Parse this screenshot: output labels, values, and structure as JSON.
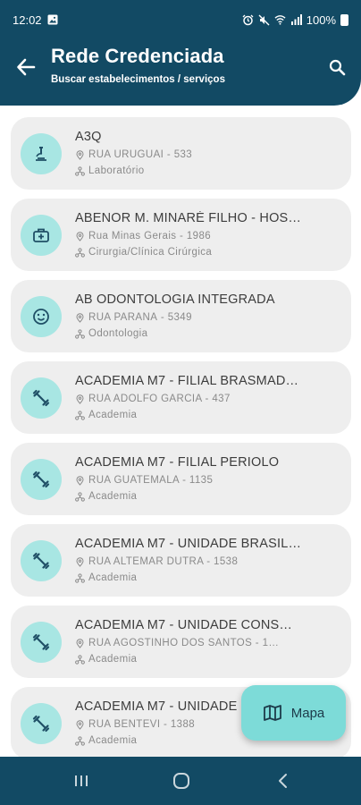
{
  "status_bar": {
    "time": "12:02",
    "battery": "100%"
  },
  "header": {
    "title": "Rede Credenciada",
    "subtitle": "Buscar estabelecimentos / serviços"
  },
  "items": [
    {
      "name": "A3Q",
      "address": "RUA URUGUAI - 533",
      "category": "Laboratório",
      "icon": "microscope-icon"
    },
    {
      "name": "ABENOR M. MINARÉ FILHO - HOS…",
      "address": "Rua Minas Gerais - 1986",
      "category": "Cirurgia/Clínica Cirúrgica",
      "icon": "medical-kit-icon"
    },
    {
      "name": "AB ODONTOLOGIA INTEGRADA",
      "address": "RUA PARANÁ - 5349",
      "category": "Odontologia",
      "icon": "smile-icon"
    },
    {
      "name": "ACADEMIA M7 - FILIAL BRASMAD…",
      "address": "RUA ADOLFO GARCIA - 437",
      "category": "Academia",
      "icon": "fitness-icon"
    },
    {
      "name": "ACADEMIA M7 - FILIAL PERIOLO",
      "address": "RUA GUATEMALA - 1135",
      "category": "Academia",
      "icon": "fitness-icon"
    },
    {
      "name": "ACADEMIA M7 - UNIDADE BRASIL…",
      "address": "RUA ALTEMAR DUTRA - 1538",
      "category": "Academia",
      "icon": "fitness-icon"
    },
    {
      "name": "ACADEMIA M7  - UNIDADE CONS…",
      "address": "RUA AGOSTINHO DOS SANTOS - 1…",
      "category": "Academia",
      "icon": "fitness-icon"
    },
    {
      "name": "ACADEMIA M7 - UNIDADE",
      "address": "RUA BENTEVI - 1388",
      "category": "Academia",
      "icon": "fitness-icon"
    }
  ],
  "fab": {
    "label": "Mapa",
    "icon": "map-icon"
  },
  "colors": {
    "header_bg": "#124a64",
    "card_bg": "#eeeeee",
    "icon_circle": "#a8e6e3",
    "fab_bg": "#7ddbd8"
  }
}
